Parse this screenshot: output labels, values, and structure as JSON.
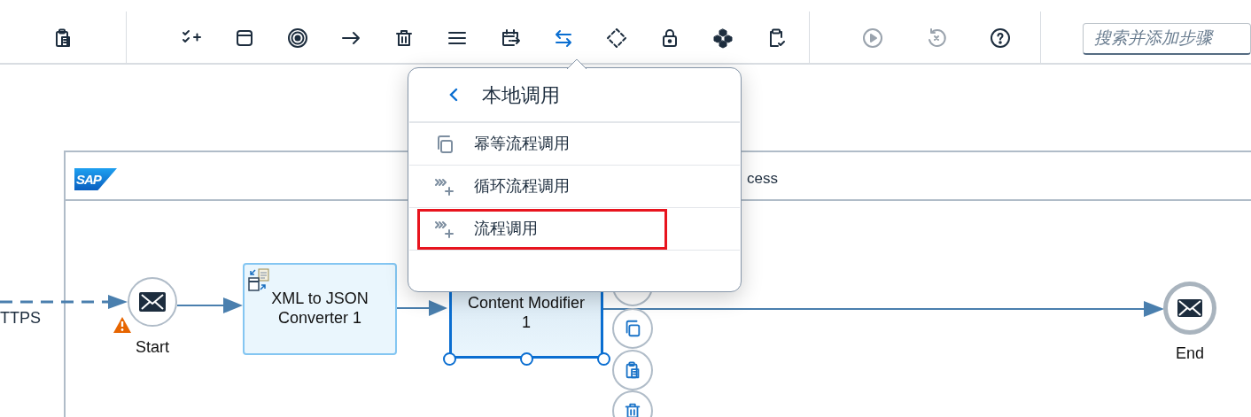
{
  "toolbar": {
    "groups": [
      [
        {
          "kind": "paste"
        }
      ],
      [
        {
          "kind": "checklist-add",
          "selected": false,
          "disabled": false
        },
        {
          "kind": "window",
          "selected": false,
          "disabled": false
        },
        {
          "kind": "target",
          "selected": false,
          "disabled": false
        },
        {
          "kind": "arrow",
          "selected": false,
          "disabled": false
        },
        {
          "kind": "trash",
          "selected": false,
          "disabled": false
        },
        {
          "kind": "lines",
          "selected": false,
          "disabled": false
        },
        {
          "kind": "calendar-arrow",
          "selected": false,
          "disabled": false
        },
        {
          "kind": "swap",
          "selected": true,
          "disabled": false
        },
        {
          "kind": "diamond",
          "selected": false,
          "disabled": false
        },
        {
          "kind": "lock",
          "selected": false,
          "disabled": false
        },
        {
          "kind": "cubes",
          "selected": false,
          "disabled": false
        },
        {
          "kind": "clipboard-check",
          "selected": false,
          "disabled": false
        }
      ],
      [
        {
          "kind": "play",
          "disabled": true
        },
        {
          "kind": "undo-x",
          "disabled": true
        },
        {
          "kind": "help",
          "disabled": false
        }
      ]
    ],
    "search": {
      "placeholder": "搜索并添加步骤"
    }
  },
  "popup": {
    "title": "本地调用",
    "items": [
      {
        "kind": "copy",
        "label": "幂等流程调用",
        "highlighted": false
      },
      {
        "kind": "chevrons-add",
        "label": "循环流程调用",
        "highlighted": false
      },
      {
        "kind": "chevrons-add",
        "label": "流程调用",
        "highlighted": true
      }
    ]
  },
  "diagram": {
    "logo": "SAP",
    "pool_title": "cess",
    "incoming_label": "TTPS",
    "start_event": {
      "label": "Start",
      "warning": true
    },
    "steps": [
      {
        "label": "XML to JSON Converter 1",
        "selected": false
      },
      {
        "label": "Content Modifier 1",
        "selected": true
      }
    ],
    "end_event": {
      "label": "End"
    }
  }
}
